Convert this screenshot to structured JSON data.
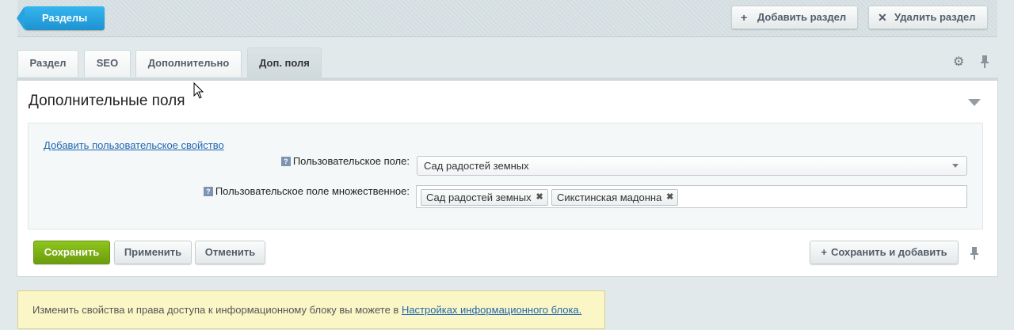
{
  "toolbar": {
    "sections_label": "Разделы",
    "add_section_label": "Добавить раздел",
    "delete_section_label": "Удалить раздел"
  },
  "tabs": [
    {
      "label": "Раздел",
      "active": false
    },
    {
      "label": "SEO",
      "active": false
    },
    {
      "label": "Дополнительно",
      "active": false
    },
    {
      "label": "Доп. поля",
      "active": true
    }
  ],
  "panel": {
    "title": "Дополнительные поля",
    "add_property_link": "Добавить пользовательское свойство",
    "fields": {
      "single_label": "Пользовательское поле:",
      "single_value": "Сад радостей земных",
      "multiple_label": "Пользовательское поле множественное:",
      "multiple_values": [
        "Сад радостей земных",
        "Сикстинская мадонна"
      ]
    },
    "hint_glyph": "?"
  },
  "buttons": {
    "save": "Сохранить",
    "apply": "Применить",
    "cancel": "Отменить",
    "save_and_add": "Сохранить и добавить"
  },
  "notice": {
    "text": "Изменить свойства и права доступа к информационному блоку вы можете в ",
    "link": "Настройках информационного блока."
  },
  "icons": {
    "plus": "+",
    "cross": "✕",
    "remove": "✖",
    "gear": "⚙",
    "pin": "📌"
  },
  "colors": {
    "primary_blue": "#1e93d1",
    "save_green": "#7bb014",
    "link_blue": "#2067b0",
    "notice_bg": "#fbf6c6"
  }
}
